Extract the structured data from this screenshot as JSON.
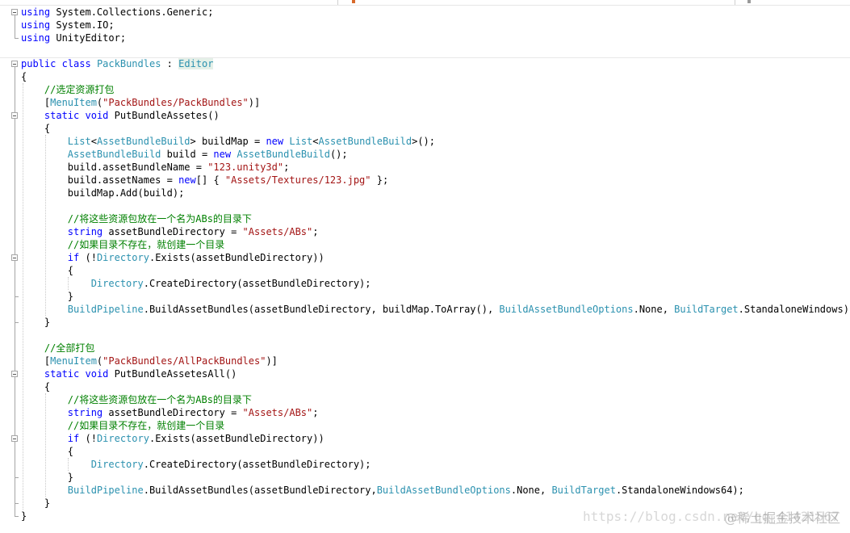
{
  "code_lines": [
    [
      {
        "t": "using",
        "c": "kw"
      },
      {
        "t": " System.Collections.Generic;"
      }
    ],
    [
      {
        "t": "using",
        "c": "kw"
      },
      {
        "t": " System.IO;"
      }
    ],
    [
      {
        "t": "using",
        "c": "kw"
      },
      {
        "t": " UnityEditor;"
      }
    ],
    [],
    [
      {
        "t": "public",
        "c": "kw"
      },
      {
        "t": " "
      },
      {
        "t": "class",
        "c": "kw"
      },
      {
        "t": " "
      },
      {
        "t": "PackBundles",
        "c": "ty"
      },
      {
        "t": " : "
      },
      {
        "t": "Editor",
        "c": "ty hl"
      }
    ],
    [
      {
        "t": "{"
      }
    ],
    [
      {
        "t": "    "
      },
      {
        "t": "//选定资源打包",
        "c": "cmt"
      }
    ],
    [
      {
        "t": "    ["
      },
      {
        "t": "MenuItem",
        "c": "ty"
      },
      {
        "t": "("
      },
      {
        "t": "\"PackBundles/PackBundles\"",
        "c": "str"
      },
      {
        "t": ")]"
      }
    ],
    [
      {
        "t": "    "
      },
      {
        "t": "static",
        "c": "kw"
      },
      {
        "t": " "
      },
      {
        "t": "void",
        "c": "kw"
      },
      {
        "t": " PutBundleAssetes()"
      }
    ],
    [
      {
        "t": "    {"
      }
    ],
    [
      {
        "t": "        "
      },
      {
        "t": "List",
        "c": "ty"
      },
      {
        "t": "<"
      },
      {
        "t": "AssetBundleBuild",
        "c": "ty"
      },
      {
        "t": "> buildMap = "
      },
      {
        "t": "new",
        "c": "kw"
      },
      {
        "t": " "
      },
      {
        "t": "List",
        "c": "ty"
      },
      {
        "t": "<"
      },
      {
        "t": "AssetBundleBuild",
        "c": "ty"
      },
      {
        "t": ">();"
      }
    ],
    [
      {
        "t": "        "
      },
      {
        "t": "AssetBundleBuild",
        "c": "ty"
      },
      {
        "t": " build = "
      },
      {
        "t": "new",
        "c": "kw"
      },
      {
        "t": " "
      },
      {
        "t": "AssetBundleBuild",
        "c": "ty"
      },
      {
        "t": "();"
      }
    ],
    [
      {
        "t": "        build.assetBundleName = "
      },
      {
        "t": "\"123.unity3d\"",
        "c": "str"
      },
      {
        "t": ";"
      }
    ],
    [
      {
        "t": "        build.assetNames = "
      },
      {
        "t": "new",
        "c": "kw"
      },
      {
        "t": "[] { "
      },
      {
        "t": "\"Assets/Textures/123.jpg\"",
        "c": "str"
      },
      {
        "t": " };"
      }
    ],
    [
      {
        "t": "        buildMap.Add(build);"
      }
    ],
    [],
    [
      {
        "t": "        "
      },
      {
        "t": "//将这些资源包放在一个名为ABs的目录下",
        "c": "cmt"
      }
    ],
    [
      {
        "t": "        "
      },
      {
        "t": "string",
        "c": "kw"
      },
      {
        "t": " assetBundleDirectory = "
      },
      {
        "t": "\"Assets/ABs\"",
        "c": "str"
      },
      {
        "t": ";"
      }
    ],
    [
      {
        "t": "        "
      },
      {
        "t": "//如果目录不存在，就创建一个目录",
        "c": "cmt"
      }
    ],
    [
      {
        "t": "        "
      },
      {
        "t": "if",
        "c": "kw"
      },
      {
        "t": " (!"
      },
      {
        "t": "Directory",
        "c": "ty"
      },
      {
        "t": ".Exists(assetBundleDirectory))"
      }
    ],
    [
      {
        "t": "        {"
      }
    ],
    [
      {
        "t": "            "
      },
      {
        "t": "Directory",
        "c": "ty"
      },
      {
        "t": ".CreateDirectory(assetBundleDirectory);"
      }
    ],
    [
      {
        "t": "        }"
      }
    ],
    [
      {
        "t": "        "
      },
      {
        "t": "BuildPipeline",
        "c": "ty"
      },
      {
        "t": ".BuildAssetBundles(assetBundleDirectory, buildMap.ToArray(), "
      },
      {
        "t": "BuildAssetBundleOptions",
        "c": "ty"
      },
      {
        "t": ".None, "
      },
      {
        "t": "BuildTarget",
        "c": "ty"
      },
      {
        "t": ".StandaloneWindows);"
      }
    ],
    [
      {
        "t": "    }"
      }
    ],
    [],
    [
      {
        "t": "    "
      },
      {
        "t": "//全部打包",
        "c": "cmt"
      }
    ],
    [
      {
        "t": "    ["
      },
      {
        "t": "MenuItem",
        "c": "ty"
      },
      {
        "t": "("
      },
      {
        "t": "\"PackBundles/AllPackBundles\"",
        "c": "str"
      },
      {
        "t": ")]"
      }
    ],
    [
      {
        "t": "    "
      },
      {
        "t": "static",
        "c": "kw"
      },
      {
        "t": " "
      },
      {
        "t": "void",
        "c": "kw"
      },
      {
        "t": " PutBundleAssetesAll()"
      }
    ],
    [
      {
        "t": "    {"
      }
    ],
    [
      {
        "t": "        "
      },
      {
        "t": "//将这些资源包放在一个名为ABs的目录下",
        "c": "cmt"
      }
    ],
    [
      {
        "t": "        "
      },
      {
        "t": "string",
        "c": "kw"
      },
      {
        "t": " assetBundleDirectory = "
      },
      {
        "t": "\"Assets/ABs\"",
        "c": "str"
      },
      {
        "t": ";"
      }
    ],
    [
      {
        "t": "        "
      },
      {
        "t": "//如果目录不存在，就创建一个目录",
        "c": "cmt"
      }
    ],
    [
      {
        "t": "        "
      },
      {
        "t": "if",
        "c": "kw"
      },
      {
        "t": " (!"
      },
      {
        "t": "Directory",
        "c": "ty"
      },
      {
        "t": ".Exists(assetBundleDirectory))"
      }
    ],
    [
      {
        "t": "        {"
      }
    ],
    [
      {
        "t": "            "
      },
      {
        "t": "Directory",
        "c": "ty"
      },
      {
        "t": ".CreateDirectory(assetBundleDirectory);"
      }
    ],
    [
      {
        "t": "        }"
      }
    ],
    [
      {
        "t": "        "
      },
      {
        "t": "BuildPipeline",
        "c": "ty"
      },
      {
        "t": ".BuildAssetBundles(assetBundleDirectory,"
      },
      {
        "t": "BuildAssetBundleOptions",
        "c": "ty"
      },
      {
        "t": ".None, "
      },
      {
        "t": "BuildTarget",
        "c": "ty"
      },
      {
        "t": ".StandaloneWindows64);"
      }
    ],
    [
      {
        "t": "    }"
      }
    ],
    [
      {
        "t": "}"
      }
    ]
  ],
  "watermark": {
    "url_text": "https://blog.csdn.net/qq_41421567",
    "site_text": "@稀土掘金技术社区"
  },
  "colors": {
    "keyword": "#0000ff",
    "type": "#2b91af",
    "string": "#a31515",
    "comment": "#008000",
    "highlight": "#e5f0e8"
  }
}
